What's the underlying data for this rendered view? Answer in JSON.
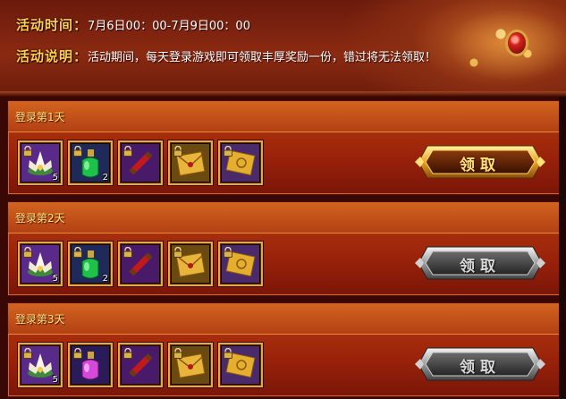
{
  "header": {
    "time_label": "活动时间：",
    "time_value": "7月6日00：00-7月9日00：00",
    "desc_label": "活动说明：",
    "desc_value": "活动期间，每天登录游戏即可领取丰厚奖励一份，错过将无法领取！"
  },
  "days": [
    {
      "title": "登录第1天",
      "button_label": "领取",
      "button_state": "active",
      "items": [
        {
          "icon": "lotus-flower-icon",
          "quantity": "5"
        },
        {
          "icon": "green-potion-icon",
          "quantity": "2"
        },
        {
          "icon": "red-scroll-icon",
          "quantity": ""
        },
        {
          "icon": "gold-envelope-icon",
          "quantity": ""
        },
        {
          "icon": "gold-ticket-icon",
          "quantity": ""
        }
      ]
    },
    {
      "title": "登录第2天",
      "button_label": "领取",
      "button_state": "disabled",
      "items": [
        {
          "icon": "lotus-flower-icon",
          "quantity": "5"
        },
        {
          "icon": "green-potion-icon",
          "quantity": "2"
        },
        {
          "icon": "red-scroll-icon",
          "quantity": ""
        },
        {
          "icon": "gold-envelope-icon",
          "quantity": ""
        },
        {
          "icon": "gold-ticket-icon",
          "quantity": ""
        }
      ]
    },
    {
      "title": "登录第3天",
      "button_label": "领取",
      "button_state": "disabled",
      "items": [
        {
          "icon": "lotus-flower-icon",
          "quantity": "5"
        },
        {
          "icon": "purple-potion-icon",
          "quantity": ""
        },
        {
          "icon": "red-scroll-icon",
          "quantity": ""
        },
        {
          "icon": "gold-envelope-icon",
          "quantity": ""
        },
        {
          "icon": "gold-ticket-icon",
          "quantity": ""
        }
      ]
    }
  ],
  "colors": {
    "label_gold": "#ffce4a",
    "day_title": "#ffe57a",
    "slot_border": "#e2a84a",
    "active_button": "#ffe07a",
    "inactive_button": "#d8d8d8"
  }
}
